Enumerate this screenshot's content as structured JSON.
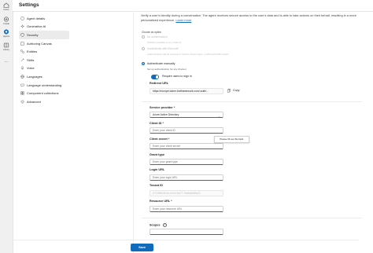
{
  "rail": {
    "items": [
      {
        "label": "Home",
        "icon": "home-icon"
      },
      {
        "label": "Create",
        "icon": "create-icon"
      },
      {
        "label": "Agents",
        "icon": "agents-icon"
      },
      {
        "label": "Library",
        "icon": "library-icon"
      },
      {
        "label": "...",
        "icon": "more-icon"
      }
    ]
  },
  "header": {
    "title": "Settings"
  },
  "sidebar": {
    "items": [
      {
        "label": "Agent details",
        "icon": "agent-details-icon"
      },
      {
        "label": "Generative AI",
        "icon": "generative-ai-icon"
      },
      {
        "label": "Security",
        "icon": "security-icon",
        "active": true
      },
      {
        "label": "Authoring Canvas",
        "icon": "authoring-canvas-icon"
      },
      {
        "label": "Entities",
        "icon": "entities-icon"
      },
      {
        "label": "Skills",
        "icon": "skills-icon"
      },
      {
        "label": "Voice",
        "icon": "voice-icon"
      },
      {
        "label": "Languages",
        "icon": "languages-icon"
      },
      {
        "label": "Language understanding",
        "icon": "language-understanding-icon"
      },
      {
        "label": "Component collections",
        "icon": "component-collections-icon"
      },
      {
        "label": "Advanced",
        "icon": "advanced-icon"
      }
    ]
  },
  "main": {
    "description": "Verify a user's identity during a conversation. The agent receives secure access to the user's data and is able to take actions on their behalf, resulting in a more personalized experience.",
    "learn_more": "Learn more",
    "choose_label": "Choose an option",
    "options": [
      {
        "label": "No authentication",
        "sub": ""
      },
      {
        "label": "Publicly available in any channel",
        "sub": ""
      },
      {
        "label": "Authenticate with Microsoft",
        "sub": ""
      },
      {
        "label": "Authentication will be required in Teams, Power Apps, or Microsoft 365 Copilot",
        "sub": ""
      },
      {
        "label": "Authenticate manually",
        "selected": true
      }
    ],
    "manual_hint": "Set up authentication for any channel",
    "require_sign_in": "Require users to sign in",
    "redirect_url_label": "Redirect URL",
    "redirect_url_value": "https://europe.token.botframework.com/.auth/...",
    "copy_label": "Copy",
    "service_provider_label": "Service provider *",
    "service_provider_value": "Azure Active Directory",
    "client_id_label": "Client ID *",
    "client_id_placeholder": "Enter your client ID",
    "client_secret_label": "Client secret *",
    "client_secret_placeholder": "Enter your client secret",
    "tooltip": "Please fill out this field.",
    "grant_type_label": "Grant type",
    "grant_type_placeholder": "Enter your grant type",
    "login_url_label": "Login URL",
    "login_url_placeholder": "Enter your login URL",
    "tenant_id_label": "Tenant ID",
    "tenant_id_value": "b71f2f6f-8e3a-4e1b-9c27-7da8d4d5fa21",
    "resource_url_label": "Resource URL *",
    "resource_url_placeholder": "Enter your resource URL",
    "scopes_label": "Scopes",
    "save_label": "Save"
  },
  "colors": {
    "accent": "#0f6cbd"
  }
}
